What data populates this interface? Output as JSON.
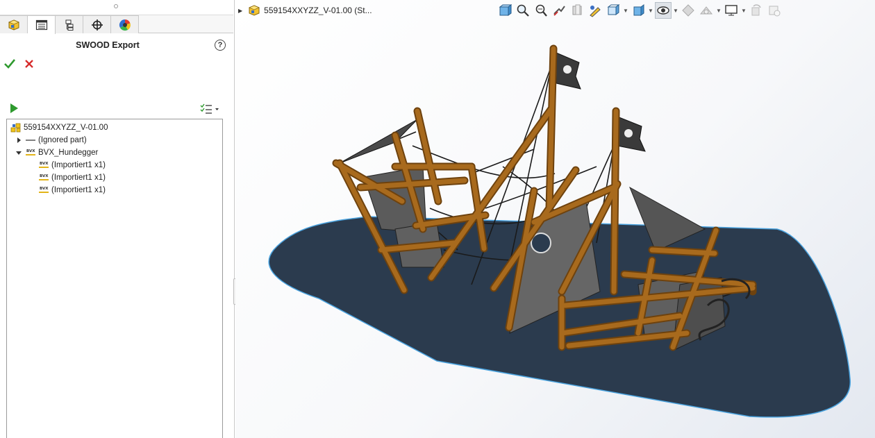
{
  "panel": {
    "title": "SWOOD Export",
    "help_glyph": "?",
    "tabs": [
      {
        "name": "feature-manager",
        "icon": "assembly-icon"
      },
      {
        "name": "property-manager",
        "icon": "property-list-icon",
        "active": true
      },
      {
        "name": "configuration-manager",
        "icon": "configuration-icon"
      },
      {
        "name": "dimxpert-manager",
        "icon": "crosshair-icon"
      },
      {
        "name": "display-manager",
        "icon": "color-wheel-icon"
      }
    ],
    "ok_icon": "checkmark-icon",
    "cancel_icon": "close-x-icon",
    "run_icon": "play-icon",
    "options_icon": "list-options-icon"
  },
  "tree": {
    "root": {
      "label": "559154XXYZZ_V-01.00",
      "icon": "assembly-icon"
    },
    "items": [
      {
        "label": "(Ignored part)",
        "level": 1,
        "expander": "collapsed",
        "icon": "line-icon"
      },
      {
        "label": "BVX_Hundegger",
        "level": 1,
        "expander": "expanded",
        "icon": "bvx-icon",
        "icon_text": "BVX"
      },
      {
        "label": "(Importiert1 x1)",
        "level": 2,
        "icon": "bvx-icon",
        "icon_text": "BVX"
      },
      {
        "label": "(Importiert1 x1)",
        "level": 2,
        "icon": "bvx-icon",
        "icon_text": "BVX"
      },
      {
        "label": "(Importiert1 x1)",
        "level": 2,
        "icon": "bvx-icon",
        "icon_text": "BVX"
      }
    ]
  },
  "viewport": {
    "document_title": "559154XXYZZ_V-01.00  (St...",
    "hud_icons": [
      "zoom-to-fit-icon",
      "zoom-to-area-icon",
      "zoom-in-out-icon",
      "previous-view-icon",
      "section-view-icon",
      "dynamic-annotation-icon",
      "view-orientation-icon",
      "display-style-icon",
      "hide-show-items-icon",
      "edit-appearance-icon",
      "apply-scene-icon",
      "view-settings-icon",
      "rotate-view-icon",
      "realview-icon"
    ],
    "colors": {
      "ground": "#2b3b4e",
      "ground_edge": "#4aa3df",
      "timber": "#a86a1d",
      "timber_dark": "#6e420e",
      "panel": "#5b5b5b",
      "sail": "#4a4a4a",
      "rope": "#1a1a1a"
    }
  }
}
